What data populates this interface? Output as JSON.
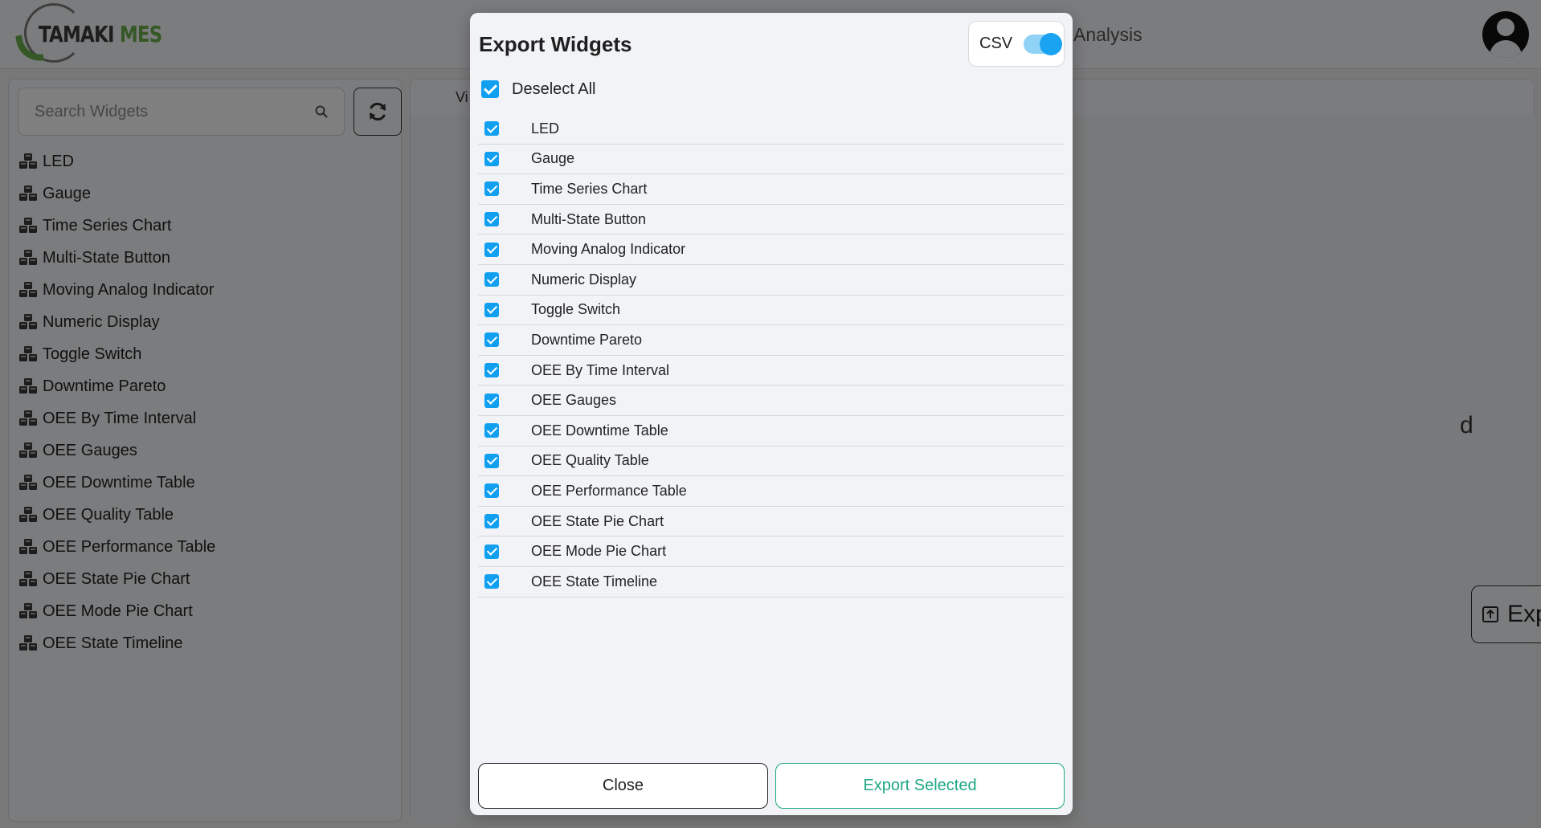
{
  "app": {
    "brand_part1": "TAMAKI",
    "brand_part2": "MES",
    "nav_analysis": "Analysis"
  },
  "sidebar": {
    "search_placeholder": "Search Widgets",
    "widgets": [
      "LED",
      "Gauge",
      "Time Series Chart",
      "Multi-State Button",
      "Moving Analog Indicator",
      "Numeric Display",
      "Toggle Switch",
      "Downtime Pareto",
      "OEE By Time Interval",
      "OEE Gauges",
      "OEE Downtime Table",
      "OEE Quality Table",
      "OEE Performance Table",
      "OEE State Pie Chart",
      "OEE Mode Pie Chart",
      "OEE State Timeline"
    ]
  },
  "main": {
    "tab_fragment": "Vi",
    "text_fragment": "d",
    "export_button_label": "Export"
  },
  "modal": {
    "title": "Export Widgets",
    "csv_label": "CSV",
    "csv_enabled": true,
    "deselect_all_label": "Deselect All",
    "items": [
      {
        "label": "LED",
        "checked": true
      },
      {
        "label": "Gauge",
        "checked": true
      },
      {
        "label": "Time Series Chart",
        "checked": true
      },
      {
        "label": "Multi-State Button",
        "checked": true
      },
      {
        "label": "Moving Analog Indicator",
        "checked": true
      },
      {
        "label": "Numeric Display",
        "checked": true
      },
      {
        "label": "Toggle Switch",
        "checked": true
      },
      {
        "label": "Downtime Pareto",
        "checked": true
      },
      {
        "label": "OEE By Time Interval",
        "checked": true
      },
      {
        "label": "OEE Gauges",
        "checked": true
      },
      {
        "label": "OEE Downtime Table",
        "checked": true
      },
      {
        "label": "OEE Quality Table",
        "checked": true
      },
      {
        "label": "OEE Performance Table",
        "checked": true
      },
      {
        "label": "OEE State Pie Chart",
        "checked": true
      },
      {
        "label": "OEE Mode Pie Chart",
        "checked": true
      },
      {
        "label": "OEE State Timeline",
        "checked": true
      }
    ],
    "close_label": "Close",
    "export_selected_label": "Export Selected"
  },
  "colors": {
    "accent_blue": "#119ff0",
    "accent_green": "#1fa884",
    "brand_green": "#6ab04c"
  }
}
